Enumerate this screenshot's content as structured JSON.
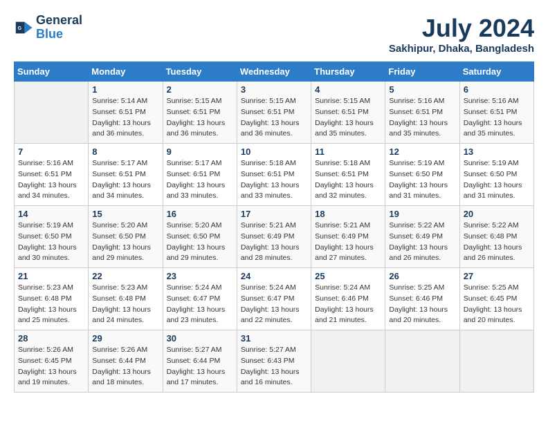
{
  "header": {
    "logo_line1": "General",
    "logo_line2": "Blue",
    "month_title": "July 2024",
    "location": "Sakhipur, Dhaka, Bangladesh"
  },
  "columns": [
    "Sunday",
    "Monday",
    "Tuesday",
    "Wednesday",
    "Thursday",
    "Friday",
    "Saturday"
  ],
  "weeks": [
    [
      {
        "day": "",
        "sunrise": "",
        "sunset": "",
        "daylight": ""
      },
      {
        "day": "1",
        "sunrise": "5:14 AM",
        "sunset": "6:51 PM",
        "daylight": "13 hours and 36 minutes."
      },
      {
        "day": "2",
        "sunrise": "5:15 AM",
        "sunset": "6:51 PM",
        "daylight": "13 hours and 36 minutes."
      },
      {
        "day": "3",
        "sunrise": "5:15 AM",
        "sunset": "6:51 PM",
        "daylight": "13 hours and 36 minutes."
      },
      {
        "day": "4",
        "sunrise": "5:15 AM",
        "sunset": "6:51 PM",
        "daylight": "13 hours and 35 minutes."
      },
      {
        "day": "5",
        "sunrise": "5:16 AM",
        "sunset": "6:51 PM",
        "daylight": "13 hours and 35 minutes."
      },
      {
        "day": "6",
        "sunrise": "5:16 AM",
        "sunset": "6:51 PM",
        "daylight": "13 hours and 35 minutes."
      }
    ],
    [
      {
        "day": "7",
        "sunrise": "5:16 AM",
        "sunset": "6:51 PM",
        "daylight": "13 hours and 34 minutes."
      },
      {
        "day": "8",
        "sunrise": "5:17 AM",
        "sunset": "6:51 PM",
        "daylight": "13 hours and 34 minutes."
      },
      {
        "day": "9",
        "sunrise": "5:17 AM",
        "sunset": "6:51 PM",
        "daylight": "13 hours and 33 minutes."
      },
      {
        "day": "10",
        "sunrise": "5:18 AM",
        "sunset": "6:51 PM",
        "daylight": "13 hours and 33 minutes."
      },
      {
        "day": "11",
        "sunrise": "5:18 AM",
        "sunset": "6:51 PM",
        "daylight": "13 hours and 32 minutes."
      },
      {
        "day": "12",
        "sunrise": "5:19 AM",
        "sunset": "6:50 PM",
        "daylight": "13 hours and 31 minutes."
      },
      {
        "day": "13",
        "sunrise": "5:19 AM",
        "sunset": "6:50 PM",
        "daylight": "13 hours and 31 minutes."
      }
    ],
    [
      {
        "day": "14",
        "sunrise": "5:19 AM",
        "sunset": "6:50 PM",
        "daylight": "13 hours and 30 minutes."
      },
      {
        "day": "15",
        "sunrise": "5:20 AM",
        "sunset": "6:50 PM",
        "daylight": "13 hours and 29 minutes."
      },
      {
        "day": "16",
        "sunrise": "5:20 AM",
        "sunset": "6:50 PM",
        "daylight": "13 hours and 29 minutes."
      },
      {
        "day": "17",
        "sunrise": "5:21 AM",
        "sunset": "6:49 PM",
        "daylight": "13 hours and 28 minutes."
      },
      {
        "day": "18",
        "sunrise": "5:21 AM",
        "sunset": "6:49 PM",
        "daylight": "13 hours and 27 minutes."
      },
      {
        "day": "19",
        "sunrise": "5:22 AM",
        "sunset": "6:49 PM",
        "daylight": "13 hours and 26 minutes."
      },
      {
        "day": "20",
        "sunrise": "5:22 AM",
        "sunset": "6:48 PM",
        "daylight": "13 hours and 26 minutes."
      }
    ],
    [
      {
        "day": "21",
        "sunrise": "5:23 AM",
        "sunset": "6:48 PM",
        "daylight": "13 hours and 25 minutes."
      },
      {
        "day": "22",
        "sunrise": "5:23 AM",
        "sunset": "6:48 PM",
        "daylight": "13 hours and 24 minutes."
      },
      {
        "day": "23",
        "sunrise": "5:24 AM",
        "sunset": "6:47 PM",
        "daylight": "13 hours and 23 minutes."
      },
      {
        "day": "24",
        "sunrise": "5:24 AM",
        "sunset": "6:47 PM",
        "daylight": "13 hours and 22 minutes."
      },
      {
        "day": "25",
        "sunrise": "5:24 AM",
        "sunset": "6:46 PM",
        "daylight": "13 hours and 21 minutes."
      },
      {
        "day": "26",
        "sunrise": "5:25 AM",
        "sunset": "6:46 PM",
        "daylight": "13 hours and 20 minutes."
      },
      {
        "day": "27",
        "sunrise": "5:25 AM",
        "sunset": "6:45 PM",
        "daylight": "13 hours and 20 minutes."
      }
    ],
    [
      {
        "day": "28",
        "sunrise": "5:26 AM",
        "sunset": "6:45 PM",
        "daylight": "13 hours and 19 minutes."
      },
      {
        "day": "29",
        "sunrise": "5:26 AM",
        "sunset": "6:44 PM",
        "daylight": "13 hours and 18 minutes."
      },
      {
        "day": "30",
        "sunrise": "5:27 AM",
        "sunset": "6:44 PM",
        "daylight": "13 hours and 17 minutes."
      },
      {
        "day": "31",
        "sunrise": "5:27 AM",
        "sunset": "6:43 PM",
        "daylight": "13 hours and 16 minutes."
      },
      {
        "day": "",
        "sunrise": "",
        "sunset": "",
        "daylight": ""
      },
      {
        "day": "",
        "sunrise": "",
        "sunset": "",
        "daylight": ""
      },
      {
        "day": "",
        "sunrise": "",
        "sunset": "",
        "daylight": ""
      }
    ]
  ]
}
